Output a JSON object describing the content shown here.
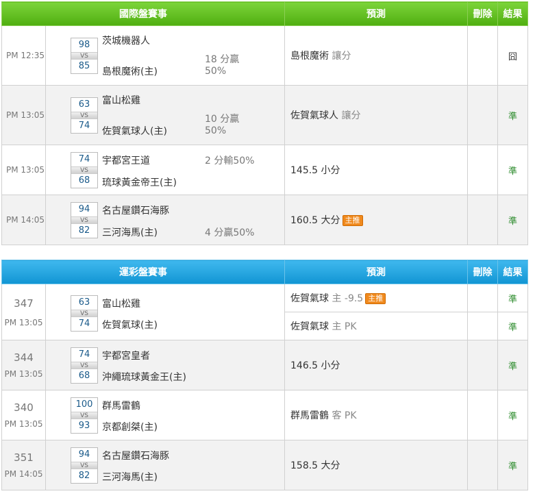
{
  "intl": {
    "headers": {
      "event": "國際盤賽事",
      "predict": "預測",
      "delete": "刪除",
      "result": "結果"
    },
    "rows": [
      {
        "time": "PM 12:35",
        "s1": "98",
        "vs": "VS",
        "s2": "85",
        "team1": "茨城機器人",
        "team2": "島根魔術(主)",
        "odds1": "18 分贏",
        "odds2": "50%",
        "pred": "島根魔術",
        "pred_note": "讓分",
        "tag": "",
        "result": "囧"
      },
      {
        "time": "PM 13:05",
        "s1": "63",
        "vs": "VS",
        "s2": "74",
        "team1": "富山松雞",
        "team2": "佐賀氣球人(主)",
        "odds1": "10 分贏",
        "odds2": "50%",
        "pred": "佐賀氣球人",
        "pred_note": "讓分",
        "tag": "",
        "result": "準"
      },
      {
        "time": "PM 13:05",
        "s1": "74",
        "vs": "VS",
        "s2": "68",
        "team1": "宇都宮王道",
        "team2": "琉球黃金帝王(主)",
        "odds1": "2 分輸50%",
        "odds2": "",
        "pred": "145.5 小分",
        "pred_note": "",
        "tag": "",
        "result": "準"
      },
      {
        "time": "PM 14:05",
        "s1": "94",
        "vs": "VS",
        "s2": "82",
        "team1": "名古屋鑽石海豚",
        "team2": "三河海馬(主)",
        "odds1": "",
        "odds2": "4 分贏50%",
        "pred": "160.5 大分",
        "pred_note": "",
        "tag": "主推",
        "result": "準"
      }
    ]
  },
  "lottery": {
    "headers": {
      "event": "運彩盤賽事",
      "predict": "預測",
      "delete": "刪除",
      "result": "結果"
    },
    "rows": [
      {
        "num": "347",
        "time": "PM 13:05",
        "s1": "63",
        "vs": "VS",
        "s2": "74",
        "team1": "富山松雞",
        "team2": "佐賀氣球(主)",
        "preds": [
          {
            "pred": "佐賀氣球",
            "note": "主 -9.5",
            "tag": "主推",
            "result": "準"
          },
          {
            "pred": "佐賀氣球",
            "note": "主 PK",
            "tag": "",
            "result": "準"
          }
        ]
      },
      {
        "num": "344",
        "time": "PM 13:05",
        "s1": "74",
        "vs": "VS",
        "s2": "68",
        "team1": "宇都宮皇者",
        "team2": "沖繩琉球黃金王(主)",
        "preds": [
          {
            "pred": "146.5 小分",
            "note": "",
            "tag": "",
            "result": "準"
          }
        ]
      },
      {
        "num": "340",
        "time": "PM 13:05",
        "s1": "100",
        "vs": "VS",
        "s2": "93",
        "team1": "群馬雷鶴",
        "team2": "京都創桀(主)",
        "preds": [
          {
            "pred": "群馬雷鶴",
            "note": "客 PK",
            "tag": "",
            "result": "準"
          }
        ]
      },
      {
        "num": "351",
        "time": "PM 14:05",
        "s1": "94",
        "vs": "VS",
        "s2": "82",
        "team1": "名古屋鑽石海豚",
        "team2": "三河海馬(主)",
        "preds": [
          {
            "pred": "158.5 大分",
            "note": "",
            "tag": "",
            "result": "準"
          }
        ]
      }
    ]
  }
}
